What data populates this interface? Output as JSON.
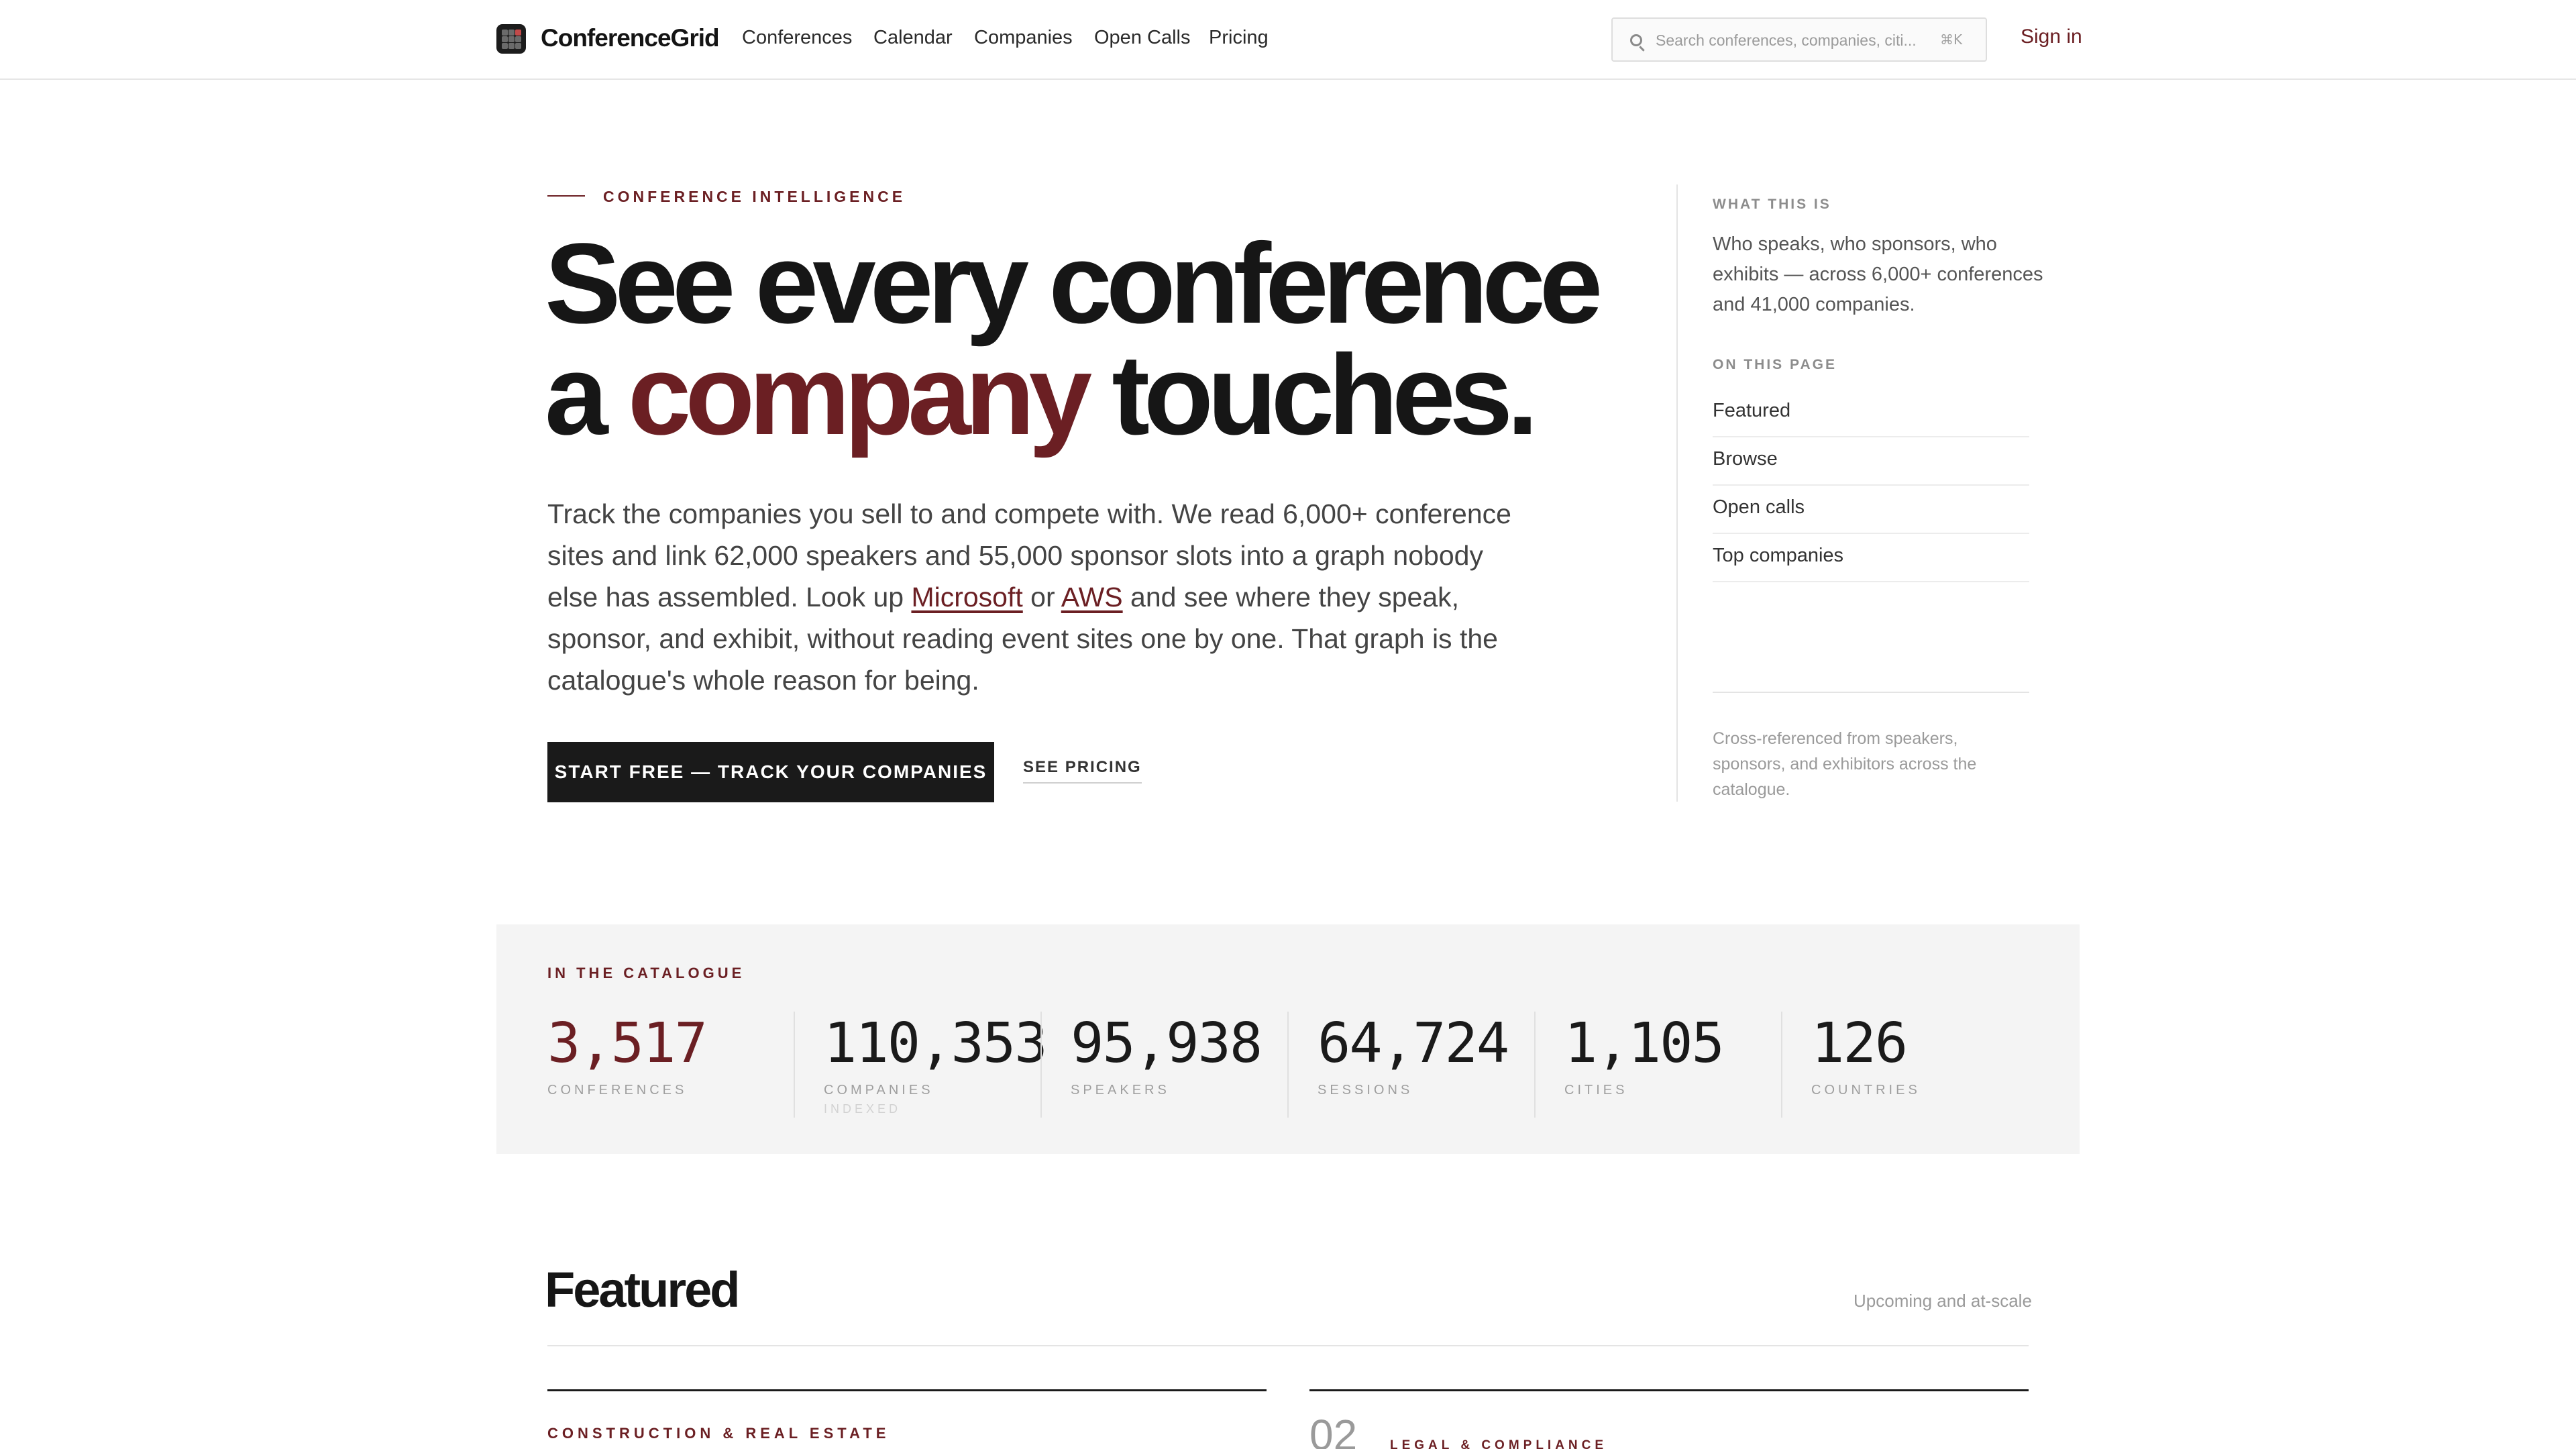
{
  "nav": {
    "brand": "ConferenceGrid",
    "links": [
      "Conferences",
      "Calendar",
      "Companies",
      "Open Calls",
      "Pricing"
    ],
    "search_placeholder": "Search conferences, companies, citi...",
    "search_shortcut": "⌘K",
    "signin": "Sign in"
  },
  "hero": {
    "eyebrow": "CONFERENCE INTELLIGENCE",
    "headline_line1": "See every conference",
    "headline_pre": "a ",
    "headline_accent": "company",
    "headline_post": " touches.",
    "lede_1": "Track the companies you sell to and compete with. We read 6,000+ conference sites and link 62,000 speakers and 55,000 sponsor slots into a graph nobody else has assembled. Look up ",
    "link_microsoft": "Microsoft",
    "lede_2": " or ",
    "link_aws": "AWS",
    "lede_3": " and see where they speak, sponsor, and exhibit, without reading event sites one by one. That graph is the catalogue's whole reason for being.",
    "cta_primary": "START FREE — TRACK YOUR COMPANIES",
    "cta_secondary": "SEE PRICING"
  },
  "aside": {
    "what_label": "WHAT THIS IS",
    "what_desc": "Who speaks, who sponsors, who exhibits — across 6,000+ conferences and 41,000 companies.",
    "toc_label": "ON THIS PAGE",
    "toc": [
      "Featured",
      "Browse",
      "Open calls",
      "Top companies"
    ],
    "note": "Cross-referenced from speakers, sponsors, and exhibitors across the catalogue."
  },
  "stats": {
    "label": "IN THE CATALOGUE",
    "items": [
      {
        "value": "3,517",
        "caption": "CONFERENCES"
      },
      {
        "value": "110,353",
        "caption": "COMPANIES",
        "sub": "INDEXED"
      },
      {
        "value": "95,938",
        "caption": "SPEAKERS"
      },
      {
        "value": "64,724",
        "caption": "SESSIONS"
      },
      {
        "value": "1,105",
        "caption": "CITIES"
      },
      {
        "value": "126",
        "caption": "COUNTRIES"
      }
    ]
  },
  "featured": {
    "title": "Featured",
    "note": "Upcoming and at-scale",
    "cards": [
      {
        "category": "CONSTRUCTION & REAL ESTATE"
      },
      {
        "number": "02",
        "category": "LEGAL & COMPLIANCE"
      }
    ]
  },
  "colors": {
    "accent": "#6b1f23",
    "ink": "#1a1a1a",
    "panel": "#f4f4f4"
  }
}
